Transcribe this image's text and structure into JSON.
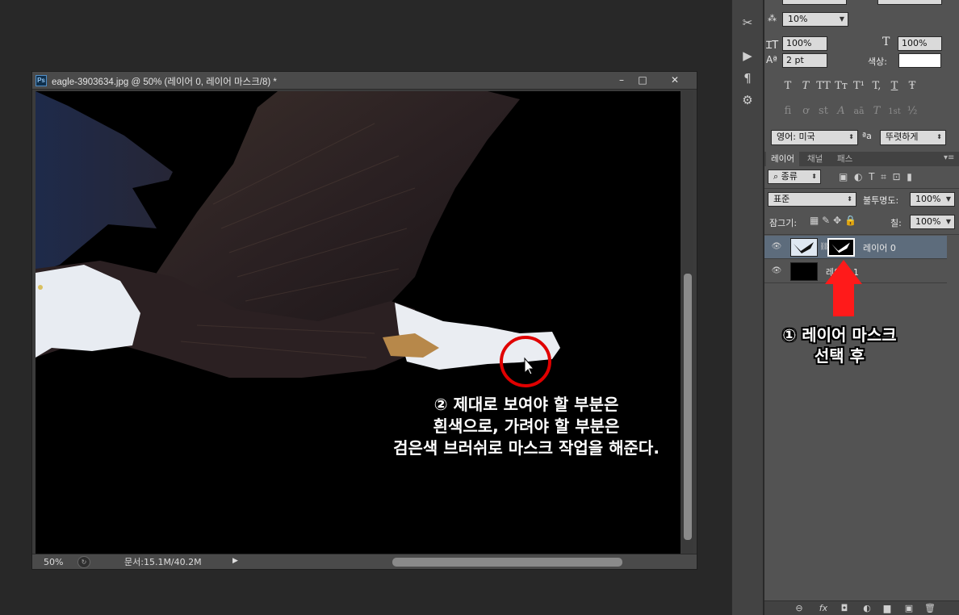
{
  "document": {
    "title": "eagle-3903634.jpg @ 50% (레이어 0, 레이어 마스크/8) *",
    "app_icon": "Ps",
    "zoom": "50%",
    "doc_info": "문서:15.1M/40.2M",
    "window_buttons": [
      "–",
      "□",
      "✕"
    ]
  },
  "tool_strip": {
    "icons": [
      "tools-icon",
      "play-icon",
      "glyph-panel-icon",
      "adjust-panel-icon"
    ]
  },
  "character_panel": {
    "tracking_value": "10%",
    "vertical_scale": "100%",
    "horizontal_scale": "100%",
    "baseline_shift": "2 pt",
    "color_label": "색상:",
    "style_glyphs": [
      "T",
      "T",
      "TT",
      "Tт",
      "T¹",
      "T,",
      "T",
      "Ŧ"
    ],
    "opentype_glyphs": [
      "fi",
      "ơ",
      "st",
      "A",
      "aā",
      "T",
      "1st",
      "½"
    ],
    "language": "영어: 미국",
    "aa_icon_label": "ªa",
    "antialias": "뚜렷하게"
  },
  "layers_panel": {
    "tabs": [
      "레이어",
      "채널",
      "패스"
    ],
    "filter_kind": "종류",
    "blend_mode": "표준",
    "opacity_label": "불투명도:",
    "opacity": "100%",
    "lock_label": "잠그기:",
    "fill_label": "칠:",
    "fill": "100%",
    "layers": [
      {
        "name": "레이어 0",
        "has_mask": true
      },
      {
        "name": "레이어 1",
        "has_mask": false
      }
    ],
    "bottom_icons": [
      "link-icon",
      "fx-icon",
      "mask-icon",
      "adjustment-icon",
      "folder-icon",
      "new-layer-icon",
      "trash-icon"
    ],
    "bottom_labels": [
      "⊖",
      "fx",
      "◘",
      "◐",
      "▆",
      "▣",
      "🗑"
    ]
  },
  "annotations": {
    "step1_line1": "① 레이어 마스크",
    "step1_line2": "선택 후",
    "step2_line1": "② 제대로 보여야 할 부분은",
    "step2_line2": "흰색으로, 가려야 할 부분은",
    "step2_line3": "검은색 브러쉬로 마스크 작업을 해준다.",
    "highlight_color": "#e00000",
    "arrow_color": "#ff1a1a"
  }
}
